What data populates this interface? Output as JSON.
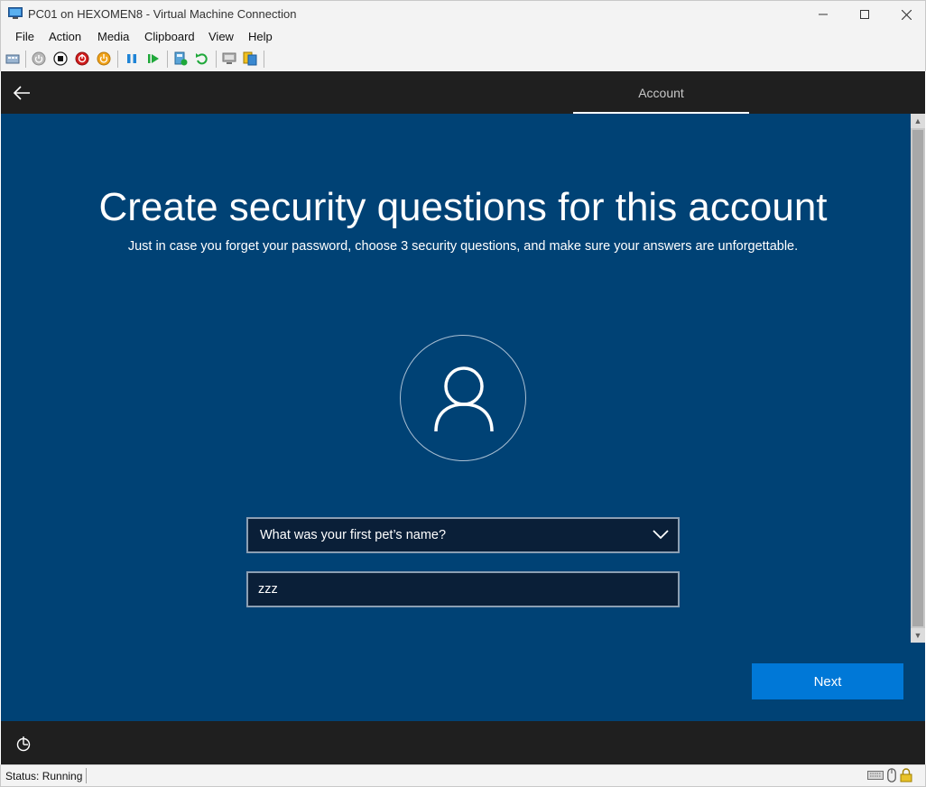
{
  "window": {
    "title": "PC01 on HEXOMEN8 - Virtual Machine Connection",
    "icon": "vm-connection-icon"
  },
  "menu": [
    "File",
    "Action",
    "Media",
    "Clipboard",
    "View",
    "Help"
  ],
  "toolbar": [
    "ctrl-alt-del-icon",
    "start-icon",
    "turn-off-icon",
    "shut-down-icon",
    "save-icon",
    "pause-icon",
    "resume-icon",
    "checkpoint-icon",
    "revert-icon",
    "enhanced-session-icon",
    "share-icon"
  ],
  "oobe": {
    "tab": "Account",
    "heading": "Create security questions for this account",
    "subheading": "Just in case you forget your password, choose 3 security questions, and make sure your answers are unforgettable.",
    "question": "What was your first pet’s name?",
    "answer": "zzz",
    "next": "Next"
  },
  "status": {
    "text": "Status: Running"
  },
  "colors": {
    "background": "#004275",
    "accent": "#0078d7",
    "header": "#1f1f1f"
  }
}
